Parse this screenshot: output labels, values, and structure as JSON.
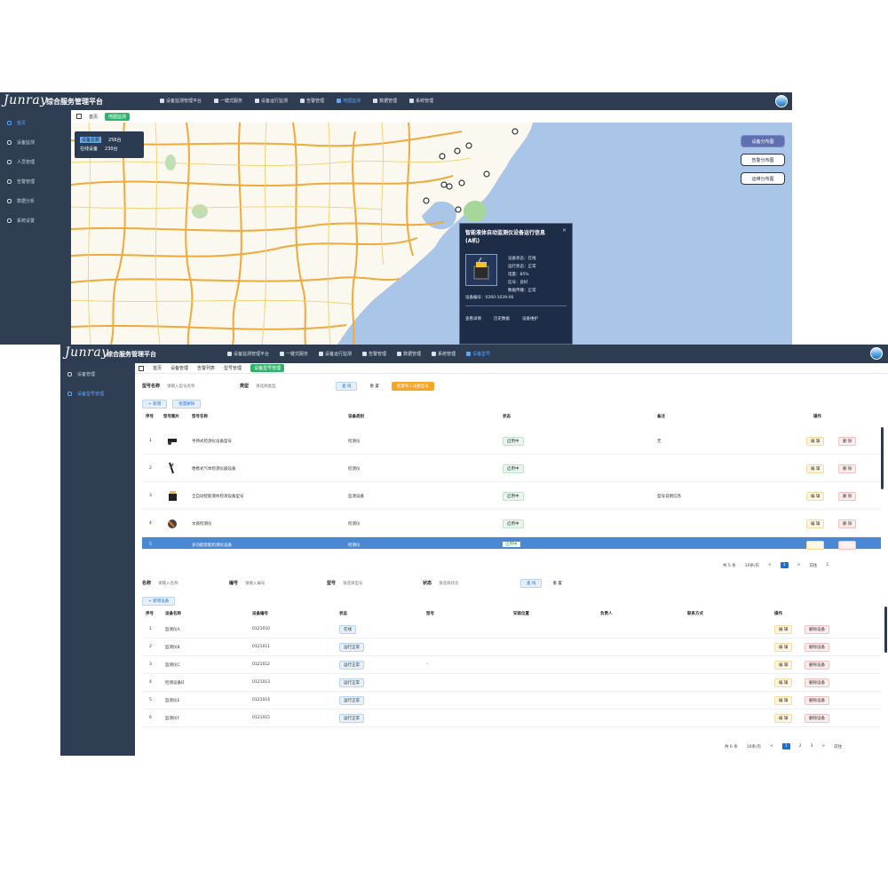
{
  "app": {
    "logo_text": "Junray",
    "system_title": "综合服务管理平台"
  },
  "colors": {
    "topbar": "#2e3d52",
    "sidebar": "#2f3e52",
    "accent": "#5aa6ff",
    "green": "#2fb36b",
    "orange": "#f5a623",
    "selected_row": "#4a88d4"
  },
  "screen1": {
    "nav": [
      "设备监测管理平台",
      "一键式服务",
      "设备运行监测",
      "告警管理",
      "地图监测",
      "数据管理",
      "系统管理"
    ],
    "active_nav": 4,
    "sidebar": [
      "首页",
      "设备监测",
      "人员管理",
      "告警管理",
      "数据分析",
      "系统设置"
    ],
    "active_side": 0,
    "tabs": [
      "首页",
      "地图监测"
    ],
    "stats": [
      {
        "label": "设备总数",
        "value": "256台"
      },
      {
        "label": "在线设备",
        "value": "230台"
      }
    ],
    "map_buttons": [
      "设备分布图",
      "告警分布图",
      "运维分布图"
    ],
    "popup": {
      "title": "智能液体自动监测仪设备运行信息(A机)",
      "close": "×",
      "attrs": [
        "设备状态：在线",
        "运行状态：正常",
        "电量：85%",
        "信号：良好",
        "数据传输：正常"
      ],
      "footer": "设备编号：0260-1039-06",
      "actions": [
        "查看详情",
        "历史数据",
        "设备维护"
      ]
    }
  },
  "screen2": {
    "nav": [
      "设备监测管理平台",
      "一键式服务",
      "设备运行监测",
      "告警管理",
      "数据管理",
      "系统管理",
      "设备型号"
    ],
    "active_nav": 6,
    "sidebar": [
      "设备管理",
      "设备型号管理"
    ],
    "active_side": 1,
    "tabs": [
      "首页",
      "设备管理",
      "告警列表",
      "型号管理",
      "设备型号管理"
    ],
    "filters1": {
      "name_label": "型号名称",
      "name_value": "请输入型号名称",
      "type_label": "类型",
      "type_value": "请选择类型",
      "search": "查 询",
      "reset": "重 置",
      "batch": "批量导入设备型号"
    },
    "toolbar1": [
      "+ 新增",
      "批量删除"
    ],
    "table1": {
      "headers": [
        "序号",
        "型号图片",
        "型号名称",
        "设备类别",
        "状态",
        "备注",
        "操作"
      ],
      "rows": [
        {
          "no": "1",
          "name": "手持式检测仪设备型号",
          "cat": "检测仪",
          "status": "启用中",
          "note": "无",
          "edit": "编 辑",
          "del": "删 除"
        },
        {
          "no": "2",
          "name": "便携式气体检测仪器设备",
          "cat": "检测仪",
          "status": "启用中",
          "note": "",
          "edit": "编 辑",
          "del": "删 除"
        },
        {
          "no": "3",
          "name": "全自动智能液体检测设备型号",
          "cat": "监测设备",
          "status": "启用中",
          "note": "型号说明信息",
          "edit": "编 辑",
          "del": "删 除"
        },
        {
          "no": "4",
          "name": "水质检测仪",
          "cat": "检测仪",
          "status": "启用中",
          "note": "",
          "edit": "编 辑",
          "del": "删 除"
        },
        {
          "no": "5",
          "name": "多功能智能检测仪设备",
          "cat": "检测仪",
          "status": "启用中",
          "note": "",
          "edit": "编 辑",
          "del": "删 除"
        }
      ]
    },
    "pager1": {
      "total": "共 5 条",
      "size": "10条/页",
      "prev": "<",
      "page": "1",
      "next": ">",
      "goto": "前往",
      "pages": "1"
    },
    "filters2": {
      "f1_label": "名称",
      "f1_value": "请输入名称",
      "f2_label": "编号",
      "f2_value": "请输入编号",
      "f3_label": "型号",
      "f3_value": "请选择型号",
      "f4_label": "状态",
      "f4_value": "请选择状态",
      "search": "查 询",
      "reset": "重 置"
    },
    "toolbar2": [
      "+ 新增设备"
    ],
    "table2": {
      "headers": [
        "序号",
        "设备名称",
        "设备编号",
        "状态",
        "型号",
        "安装位置",
        "负责人",
        "联系方式",
        "操作"
      ],
      "rows": [
        {
          "no": "1",
          "name": "监测仪A",
          "code": "0121010",
          "status": "在线",
          "model": "",
          "edit": "编 辑",
          "del": "删除设备"
        },
        {
          "no": "2",
          "name": "监测仪B",
          "code": "0121011",
          "status": "运行正常",
          "model": "",
          "edit": "编 辑",
          "del": "删除设备"
        },
        {
          "no": "3",
          "name": "监测仪C",
          "code": "0121012",
          "status": "运行正常",
          "model": "-",
          "edit": "编 辑",
          "del": "删除设备"
        },
        {
          "no": "4",
          "name": "检测设备D",
          "code": "0121013",
          "status": "运行正常",
          "model": "",
          "edit": "编 辑",
          "del": "删除设备"
        },
        {
          "no": "5",
          "name": "监测仪E",
          "code": "0121014",
          "status": "运行正常",
          "model": "",
          "edit": "编 辑",
          "del": "删除设备"
        },
        {
          "no": "6",
          "name": "监测仪F",
          "code": "0121015",
          "status": "运行正常",
          "model": "",
          "edit": "编 辑",
          "del": "删除设备"
        }
      ]
    },
    "pager2": {
      "total": "共 6 条",
      "size": "10条/页",
      "prev": "<",
      "page": "1",
      "p2": "2",
      "p3": "3",
      "next": ">",
      "goto": "前往"
    }
  }
}
